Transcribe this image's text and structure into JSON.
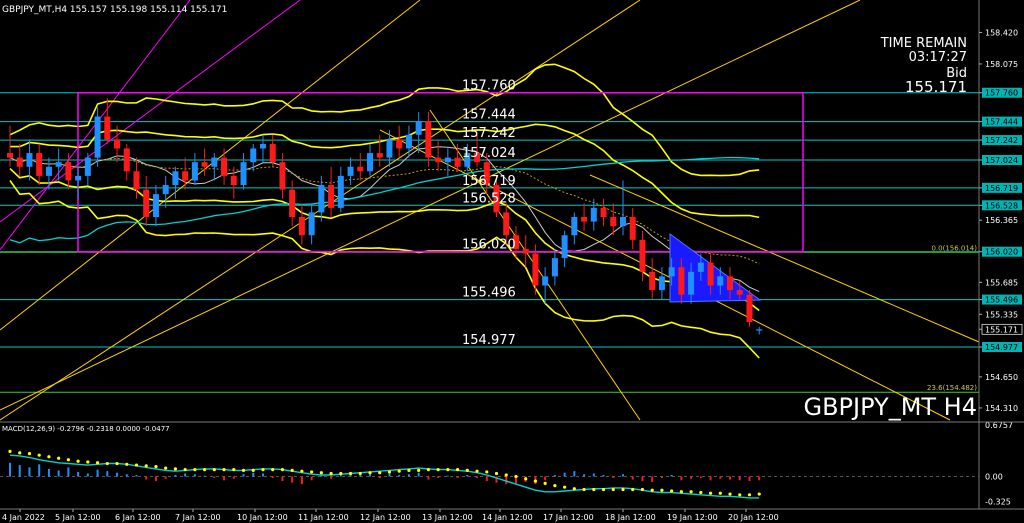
{
  "header": {
    "symbol_info": "GBPJPY_MT,H4  155.157 155.198 155.114 155.171",
    "watermark": "GBPJPY_MT H4"
  },
  "info_panel": {
    "time_remain_label": "TIME REMAIN",
    "time_remain_value": "03:17:27",
    "bid_label": "Bid",
    "bid_value": "155.171"
  },
  "colors": {
    "background": "#000000",
    "bull_candle": "#1e90ff",
    "bear_candle": "#ff1a1a",
    "bollinger": "#ffff00",
    "trendline": "#ffd000",
    "level_line": "#00c8c8",
    "rectangle": "#ff00ff",
    "ma": "#00d0d0",
    "macd_signal": "#ffff00",
    "triangle": "#1a1aff"
  },
  "chart_data": {
    "type": "candlestick",
    "price_axis_ticks": [
      "158.420",
      "158.075",
      "157.760",
      "157.444",
      "157.242",
      "157.024",
      "156.719",
      "156.528",
      "156.365",
      "156.020",
      "155.685",
      "155.496",
      "155.335",
      "155.171",
      "154.977",
      "154.650",
      "154.310"
    ],
    "highlighted_ticks": [
      "157.760",
      "157.444",
      "157.242",
      "157.024",
      "156.719",
      "156.528",
      "156.020",
      "155.496",
      "155.171",
      "154.977"
    ],
    "time_axis_labels": [
      "4 Jan 2022",
      "5 Jan 12:00",
      "6 Jan 12:00",
      "7 Jan 12:00",
      "10 Jan 12:00",
      "11 Jan 12:00",
      "12 Jan 12:00",
      "13 Jan 12:00",
      "14 Jan 12:00",
      "17 Jan 12:00",
      "18 Jan 12:00",
      "19 Jan 12:00",
      "20 Jan 12:00"
    ],
    "horizontal_levels": [
      {
        "label": "157.760",
        "value": 157.76
      },
      {
        "label": "157.444",
        "value": 157.444
      },
      {
        "label": "157.242",
        "value": 157.242
      },
      {
        "label": "157.024",
        "value": 157.024
      },
      {
        "label": "156.719",
        "value": 156.719
      },
      {
        "label": "156.528",
        "value": 156.528
      },
      {
        "label": "156.020",
        "value": 156.02
      },
      {
        "label": "155.496",
        "value": 155.496
      },
      {
        "label": "154.977",
        "value": 154.977
      }
    ],
    "fibo_levels": [
      {
        "label": "0.0(156.014)",
        "value": 156.014
      },
      {
        "label": "23.6(154.482)",
        "value": 154.482
      }
    ],
    "candles": [
      {
        "o": 157.1,
        "h": 157.4,
        "l": 156.95,
        "c": 157.05
      },
      {
        "o": 157.05,
        "h": 157.2,
        "l": 156.85,
        "c": 156.95
      },
      {
        "o": 156.95,
        "h": 157.25,
        "l": 156.8,
        "c": 157.1
      },
      {
        "o": 157.1,
        "h": 157.2,
        "l": 156.75,
        "c": 156.85
      },
      {
        "o": 156.85,
        "h": 157.05,
        "l": 156.7,
        "c": 156.95
      },
      {
        "o": 156.95,
        "h": 157.15,
        "l": 156.8,
        "c": 157.0
      },
      {
        "o": 157.0,
        "h": 157.1,
        "l": 156.7,
        "c": 156.8
      },
      {
        "o": 156.8,
        "h": 156.95,
        "l": 156.6,
        "c": 156.85
      },
      {
        "o": 156.85,
        "h": 157.1,
        "l": 156.75,
        "c": 157.05
      },
      {
        "o": 157.05,
        "h": 157.6,
        "l": 156.95,
        "c": 157.5
      },
      {
        "o": 157.5,
        "h": 157.7,
        "l": 157.2,
        "c": 157.25
      },
      {
        "o": 157.25,
        "h": 157.4,
        "l": 157.0,
        "c": 157.15
      },
      {
        "o": 157.15,
        "h": 157.2,
        "l": 156.8,
        "c": 156.9
      },
      {
        "o": 156.9,
        "h": 157.05,
        "l": 156.6,
        "c": 156.7
      },
      {
        "o": 156.7,
        "h": 156.85,
        "l": 156.3,
        "c": 156.4
      },
      {
        "o": 156.4,
        "h": 156.75,
        "l": 156.3,
        "c": 156.65
      },
      {
        "o": 156.65,
        "h": 156.85,
        "l": 156.5,
        "c": 156.75
      },
      {
        "o": 156.75,
        "h": 156.95,
        "l": 156.6,
        "c": 156.9
      },
      {
        "o": 156.9,
        "h": 157.05,
        "l": 156.7,
        "c": 156.8
      },
      {
        "o": 156.8,
        "h": 157.1,
        "l": 156.75,
        "c": 157.0
      },
      {
        "o": 157.0,
        "h": 157.15,
        "l": 156.85,
        "c": 156.95
      },
      {
        "o": 156.95,
        "h": 157.1,
        "l": 156.8,
        "c": 157.05
      },
      {
        "o": 157.05,
        "h": 157.15,
        "l": 156.75,
        "c": 156.85
      },
      {
        "o": 156.85,
        "h": 156.95,
        "l": 156.6,
        "c": 156.75
      },
      {
        "o": 156.75,
        "h": 157.1,
        "l": 156.7,
        "c": 157.0
      },
      {
        "o": 157.0,
        "h": 157.2,
        "l": 156.9,
        "c": 157.15
      },
      {
        "o": 157.15,
        "h": 157.3,
        "l": 157.0,
        "c": 157.2
      },
      {
        "o": 157.2,
        "h": 157.3,
        "l": 156.95,
        "c": 157.0
      },
      {
        "o": 157.0,
        "h": 157.1,
        "l": 156.6,
        "c": 156.7
      },
      {
        "o": 156.7,
        "h": 156.8,
        "l": 156.3,
        "c": 156.4
      },
      {
        "o": 156.4,
        "h": 156.55,
        "l": 156.1,
        "c": 156.2
      },
      {
        "o": 156.2,
        "h": 156.55,
        "l": 156.1,
        "c": 156.45
      },
      {
        "o": 156.45,
        "h": 156.85,
        "l": 156.35,
        "c": 156.75
      },
      {
        "o": 156.75,
        "h": 156.95,
        "l": 156.4,
        "c": 156.5
      },
      {
        "o": 156.5,
        "h": 156.95,
        "l": 156.45,
        "c": 156.85
      },
      {
        "o": 156.85,
        "h": 157.05,
        "l": 156.75,
        "c": 156.95
      },
      {
        "o": 156.95,
        "h": 157.1,
        "l": 156.8,
        "c": 156.9
      },
      {
        "o": 156.9,
        "h": 157.2,
        "l": 156.85,
        "c": 157.1
      },
      {
        "o": 157.1,
        "h": 157.3,
        "l": 156.95,
        "c": 157.05
      },
      {
        "o": 157.05,
        "h": 157.35,
        "l": 156.95,
        "c": 157.25
      },
      {
        "o": 157.25,
        "h": 157.4,
        "l": 157.05,
        "c": 157.15
      },
      {
        "o": 157.15,
        "h": 157.4,
        "l": 157.05,
        "c": 157.3
      },
      {
        "o": 157.3,
        "h": 157.55,
        "l": 157.1,
        "c": 157.45
      },
      {
        "o": 157.45,
        "h": 157.55,
        "l": 156.95,
        "c": 157.05
      },
      {
        "o": 157.05,
        "h": 157.25,
        "l": 156.9,
        "c": 157.0
      },
      {
        "o": 157.0,
        "h": 157.15,
        "l": 156.85,
        "c": 157.05
      },
      {
        "o": 157.05,
        "h": 157.2,
        "l": 156.9,
        "c": 156.95
      },
      {
        "o": 156.95,
        "h": 157.2,
        "l": 156.9,
        "c": 157.1
      },
      {
        "o": 157.1,
        "h": 157.3,
        "l": 156.95,
        "c": 157.0
      },
      {
        "o": 157.0,
        "h": 157.1,
        "l": 156.65,
        "c": 156.75
      },
      {
        "o": 156.75,
        "h": 156.85,
        "l": 156.4,
        "c": 156.45
      },
      {
        "o": 156.45,
        "h": 156.55,
        "l": 156.1,
        "c": 156.2
      },
      {
        "o": 156.2,
        "h": 156.3,
        "l": 155.95,
        "c": 156.05
      },
      {
        "o": 156.05,
        "h": 156.2,
        "l": 155.85,
        "c": 156.0
      },
      {
        "o": 156.0,
        "h": 156.1,
        "l": 155.55,
        "c": 155.65
      },
      {
        "o": 155.65,
        "h": 155.85,
        "l": 155.45,
        "c": 155.75
      },
      {
        "o": 155.75,
        "h": 156.05,
        "l": 155.65,
        "c": 155.95
      },
      {
        "o": 155.95,
        "h": 156.25,
        "l": 155.85,
        "c": 156.2
      },
      {
        "o": 156.2,
        "h": 156.45,
        "l": 156.1,
        "c": 156.4
      },
      {
        "o": 156.4,
        "h": 156.55,
        "l": 156.25,
        "c": 156.35
      },
      {
        "o": 156.35,
        "h": 156.6,
        "l": 156.25,
        "c": 156.5
      },
      {
        "o": 156.5,
        "h": 156.6,
        "l": 156.3,
        "c": 156.4
      },
      {
        "o": 156.4,
        "h": 156.55,
        "l": 156.2,
        "c": 156.3
      },
      {
        "o": 156.3,
        "h": 156.8,
        "l": 156.2,
        "c": 156.4
      },
      {
        "o": 156.4,
        "h": 156.5,
        "l": 156.05,
        "c": 156.15
      },
      {
        "o": 156.15,
        "h": 156.25,
        "l": 155.7,
        "c": 155.8
      },
      {
        "o": 155.8,
        "h": 155.95,
        "l": 155.5,
        "c": 155.6
      },
      {
        "o": 155.6,
        "h": 155.85,
        "l": 155.5,
        "c": 155.75
      },
      {
        "o": 155.75,
        "h": 155.95,
        "l": 155.65,
        "c": 155.85
      },
      {
        "o": 155.85,
        "h": 155.95,
        "l": 155.45,
        "c": 155.55
      },
      {
        "o": 155.55,
        "h": 155.9,
        "l": 155.45,
        "c": 155.8
      },
      {
        "o": 155.8,
        "h": 156.0,
        "l": 155.7,
        "c": 155.9
      },
      {
        "o": 155.9,
        "h": 156.0,
        "l": 155.55,
        "c": 155.65
      },
      {
        "o": 155.65,
        "h": 155.85,
        "l": 155.55,
        "c": 155.75
      },
      {
        "o": 155.75,
        "h": 155.85,
        "l": 155.5,
        "c": 155.6
      },
      {
        "o": 155.6,
        "h": 155.7,
        "l": 155.5,
        "c": 155.55
      },
      {
        "o": 155.55,
        "h": 155.6,
        "l": 155.2,
        "c": 155.25
      },
      {
        "o": 155.157,
        "h": 155.198,
        "l": 155.114,
        "c": 155.171
      }
    ],
    "macd": {
      "label": "MACD(12,26,9) -0.2796 -0.2318 0.0000 -0.0477",
      "axis_ticks": [
        "0.6757",
        "0.00",
        "-0.325"
      ],
      "histogram": [
        0.18,
        0.15,
        0.12,
        0.16,
        0.1,
        0.08,
        0.12,
        0.06,
        0.04,
        0.09,
        0.07,
        0.05,
        0.03,
        0.02,
        -0.04,
        -0.06,
        -0.03,
        0.02,
        0.04,
        0.03,
        0.01,
        -0.02,
        -0.05,
        -0.03,
        0.03,
        0.05,
        0.04,
        -0.02,
        -0.06,
        -0.08,
        -0.1,
        -0.05,
        0.02,
        -0.03,
        0.04,
        0.03,
        0.02,
        0.03,
        -0.02,
        0.04,
        0.02,
        0.03,
        0.05,
        -0.04,
        -0.02,
        0.01,
        -0.02,
        0.02,
        -0.02,
        -0.06,
        -0.08,
        -0.1,
        -0.09,
        -0.07,
        -0.1,
        -0.05,
        0.02,
        0.05,
        0.07,
        0.03,
        0.04,
        0.02,
        -0.02,
        0.03,
        -0.04,
        -0.06,
        -0.07,
        -0.02,
        0.02,
        -0.05,
        -0.03,
        -0.02,
        -0.05,
        -0.03,
        -0.04,
        -0.05,
        -0.06,
        -0.05
      ],
      "main_line": [
        0.28,
        0.27,
        0.25,
        0.22,
        0.2,
        0.18,
        0.17,
        0.16,
        0.15,
        0.16,
        0.17,
        0.17,
        0.16,
        0.14,
        0.12,
        0.1,
        0.08,
        0.07,
        0.08,
        0.09,
        0.1,
        0.1,
        0.09,
        0.08,
        0.08,
        0.09,
        0.1,
        0.1,
        0.09,
        0.07,
        0.05,
        0.03,
        0.02,
        0.02,
        0.03,
        0.04,
        0.05,
        0.06,
        0.07,
        0.08,
        0.09,
        0.1,
        0.11,
        0.1,
        0.09,
        0.09,
        0.08,
        0.07,
        0.05,
        0.02,
        -0.02,
        -0.06,
        -0.1,
        -0.14,
        -0.18,
        -0.2,
        -0.2,
        -0.19,
        -0.18,
        -0.17,
        -0.16,
        -0.16,
        -0.15,
        -0.15,
        -0.16,
        -0.18,
        -0.2,
        -0.21,
        -0.21,
        -0.22,
        -0.23,
        -0.24,
        -0.25,
        -0.26,
        -0.26,
        -0.27,
        -0.28,
        -0.28
      ],
      "signal_line": [
        0.33,
        0.31,
        0.3,
        0.28,
        0.26,
        0.24,
        0.22,
        0.2,
        0.19,
        0.18,
        0.17,
        0.17,
        0.16,
        0.15,
        0.14,
        0.13,
        0.11,
        0.1,
        0.09,
        0.09,
        0.09,
        0.09,
        0.09,
        0.09,
        0.08,
        0.08,
        0.09,
        0.09,
        0.09,
        0.08,
        0.07,
        0.06,
        0.05,
        0.04,
        0.04,
        0.04,
        0.04,
        0.05,
        0.05,
        0.06,
        0.07,
        0.08,
        0.08,
        0.09,
        0.09,
        0.09,
        0.09,
        0.08,
        0.07,
        0.06,
        0.04,
        0.02,
        0.0,
        -0.03,
        -0.06,
        -0.09,
        -0.12,
        -0.14,
        -0.16,
        -0.17,
        -0.17,
        -0.17,
        -0.17,
        -0.17,
        -0.17,
        -0.17,
        -0.18,
        -0.18,
        -0.19,
        -0.2,
        -0.2,
        -0.21,
        -0.22,
        -0.22,
        -0.23,
        -0.24,
        -0.24,
        -0.23
      ]
    }
  }
}
